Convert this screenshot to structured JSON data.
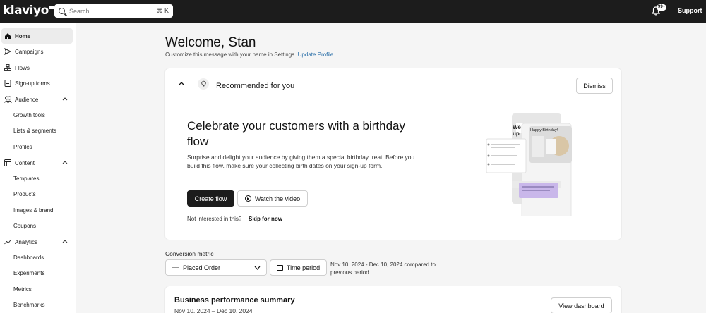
{
  "topbar": {
    "logo": "klaviyo",
    "search_placeholder": "Search",
    "search_shortcut": "⌘ K",
    "notification_count": "99+",
    "support_label": "Support"
  },
  "sidebar": {
    "items": [
      {
        "label": "Home",
        "icon": "home-icon",
        "active": true
      },
      {
        "label": "Campaigns",
        "icon": "send-icon"
      },
      {
        "label": "Flows",
        "icon": "flow-icon"
      },
      {
        "label": "Sign-up forms",
        "icon": "form-icon"
      },
      {
        "label": "Audience",
        "icon": "people-icon",
        "expanded": true
      },
      {
        "label": "Content",
        "icon": "content-icon",
        "expanded": true
      },
      {
        "label": "Analytics",
        "icon": "analytics-icon",
        "expanded": true
      }
    ],
    "audience_sub": [
      "Growth tools",
      "Lists & segments",
      "Profiles"
    ],
    "content_sub": [
      "Templates",
      "Products",
      "Images & brand",
      "Coupons"
    ],
    "analytics_sub": [
      "Dashboards",
      "Experiments",
      "Metrics",
      "Benchmarks"
    ]
  },
  "main": {
    "welcome": "Welcome, Stan",
    "subtitle": "Customize this message with your name in Settings.",
    "subtitle_link": "Update Profile",
    "recommended": {
      "title": "Recommended for you",
      "dismiss_label": "Dismiss",
      "headline": "Celebrate your customers with a birthday flow",
      "body": "Surprise and delight your audience by giving them a special birthday treat. Before you build this flow, make sure your collecting birth dates on your sign-up form.",
      "create_label": "Create flow",
      "watch_label": "Watch the video",
      "not_interested": "Not interested in this?",
      "skip_label": "Skip for now",
      "illustration_text": "Happy Birthday!",
      "illustration_partial": "We up"
    },
    "conversion": {
      "label": "Conversion metric",
      "selected": "Placed Order",
      "time_period_label": "Time period",
      "date_range": "Nov 10, 2024 - Dec 10, 2024 compared to previous period"
    },
    "performance": {
      "title": "Business performance summary",
      "date": "Nov 10, 2024 – Dec 10, 2024",
      "view_label": "View dashboard"
    }
  }
}
